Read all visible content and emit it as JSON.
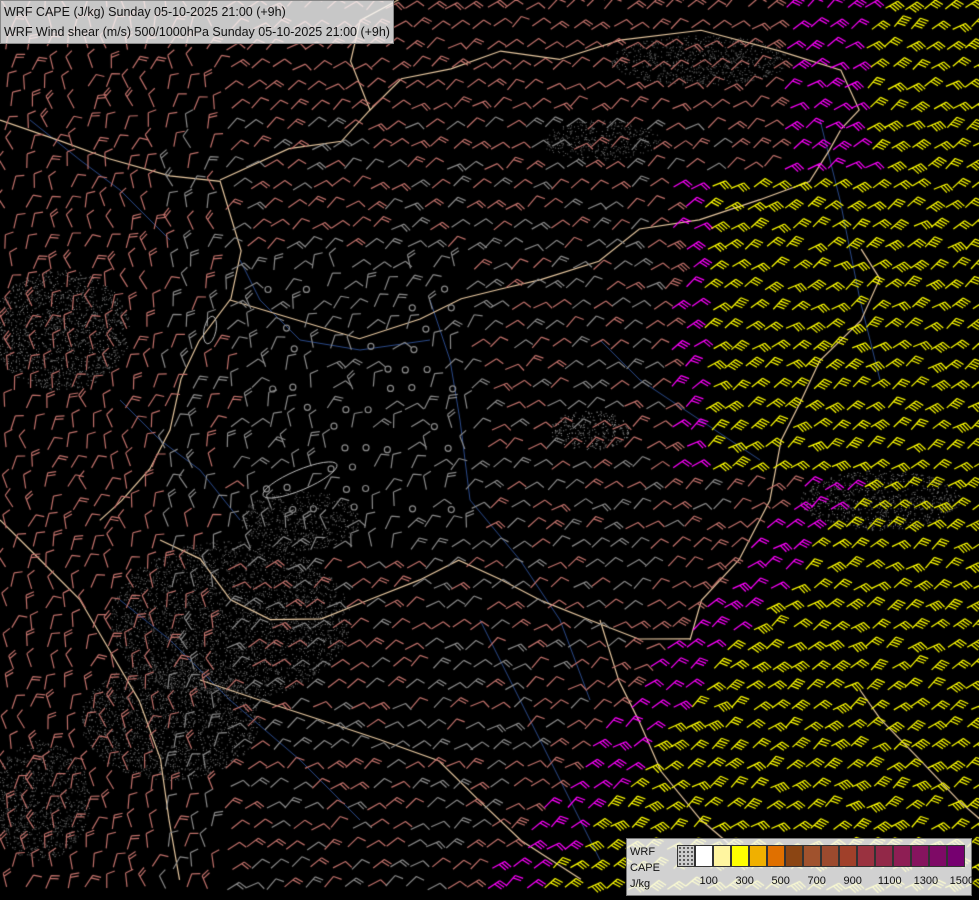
{
  "header": {
    "title_line_1": "WRF CAPE (J/kg) Sunday 05-10-2025 21:00 (+9h)",
    "title_line_2": "WRF Wind shear (m/s) 500/1000hPa Sunday 05-10-2025 21:00 (+9h)"
  },
  "legend": {
    "label_line_1": "WRF",
    "label_line_2": "CAPE",
    "label_line_3": "J/kg",
    "tick_labels": [
      "100",
      "300",
      "500",
      "700",
      "900",
      "1100",
      "1300",
      "1500"
    ],
    "colors": [
      "#bdbdbd",
      "#ffffff",
      "#fff5a0",
      "#ffff00",
      "#f0b000",
      "#e07000",
      "#8b4513",
      "#a0522d",
      "#9c4a2e",
      "#a0402a",
      "#9a3240",
      "#922848",
      "#8e1e54",
      "#86145e",
      "#7e0a66",
      "#760070"
    ]
  },
  "map": {
    "background_color": "#000000",
    "wind_barb_colors": {
      "low": "#8a8a8a",
      "medium": "#c0706a",
      "high_magenta": "#ff00ff",
      "high_yellow": "#ffff00",
      "tan": "#c8a060"
    }
  }
}
